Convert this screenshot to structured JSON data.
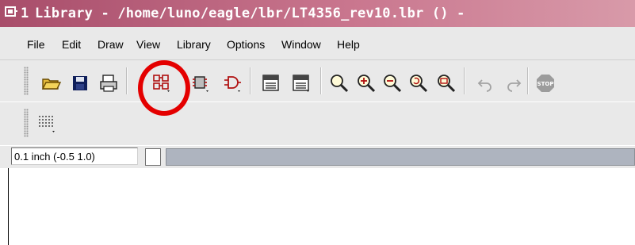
{
  "window": {
    "title_number": "1",
    "title": "Library - /home/luno/eagle/lbr/LT4356_rev10.lbr () -"
  },
  "menu": [
    {
      "label": "File"
    },
    {
      "label": "Edit"
    },
    {
      "label": "Draw"
    },
    {
      "label": "View"
    },
    {
      "label": "Library"
    },
    {
      "label": "Options"
    },
    {
      "label": "Window"
    },
    {
      "label": "Help"
    }
  ],
  "toolbar": {
    "icons": [
      "open-icon",
      "save-icon",
      "print-icon",
      "library-package-icon",
      "library-symbol-icon",
      "library-device-icon",
      "script-icon",
      "ulp-icon",
      "zoom-fit-icon",
      "zoom-in-icon",
      "zoom-out-icon",
      "zoom-redraw-icon",
      "zoom-select-icon",
      "undo-icon",
      "redo-icon",
      "stop-icon"
    ]
  },
  "toolbar2": {
    "icons": [
      "grid-icon"
    ]
  },
  "status": {
    "coordinate": "0.1 inch (-0.5 1.0)"
  },
  "annotation": {
    "color": "#e40000"
  },
  "colors": {
    "titlebar": "#a84d6a",
    "panel": "#e9e9e9",
    "command_line": "#aeb4bf"
  }
}
